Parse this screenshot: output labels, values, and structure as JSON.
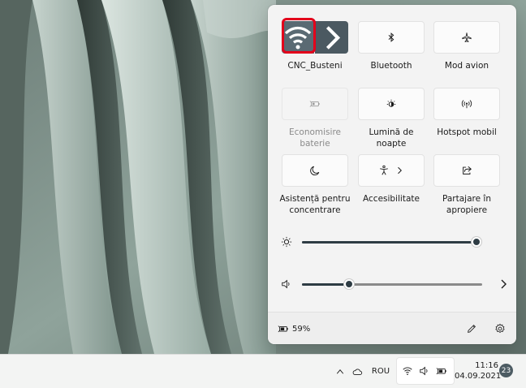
{
  "quick_settings": {
    "tiles": [
      {
        "id": "wifi",
        "label": "CNC_Busteni",
        "icon": "wifi-icon",
        "state": "on",
        "has_chevron": true
      },
      {
        "id": "bluetooth",
        "label": "Bluetooth",
        "icon": "bluetooth-icon",
        "state": "off"
      },
      {
        "id": "airplane",
        "label": "Mod avion",
        "icon": "airplane-icon",
        "state": "off"
      },
      {
        "id": "battery-saver",
        "label": "Economisire\nbaterie",
        "icon": "battery-saver-icon",
        "state": "disabled"
      },
      {
        "id": "night-light",
        "label": "Lumină de\nnoapte",
        "icon": "night-light-icon",
        "state": "off"
      },
      {
        "id": "hotspot",
        "label": "Hotspot mobil",
        "icon": "hotspot-icon",
        "state": "off"
      },
      {
        "id": "focus-assist",
        "label": "Asistență pentru\nconcentrare",
        "icon": "moon-icon",
        "state": "off"
      },
      {
        "id": "accessibility",
        "label": "Accesibilitate",
        "icon": "accessibility-icon",
        "state": "off",
        "has_chevron": true
      },
      {
        "id": "nearby-sharing",
        "label": "Partajare în\napropiere",
        "icon": "share-icon",
        "state": "off"
      }
    ],
    "brightness": {
      "icon": "brightness-icon",
      "level": 1.0
    },
    "volume": {
      "icon": "speaker-icon",
      "level": 0.26
    },
    "battery_text": "59%",
    "footer": {
      "edit_icon": "pencil-icon",
      "settings_icon": "gear-icon"
    }
  },
  "taskbar": {
    "overflow_icon": "chevron-up-icon",
    "cloud_icon": "cloud-icon",
    "language": "ROU",
    "tray_icons": [
      "wifi-icon",
      "speaker-icon",
      "battery-icon"
    ],
    "time": "11:16",
    "date": "04.09.2021",
    "notification_count": "23"
  },
  "colors": {
    "accent_on": "#4c5a62",
    "highlight": "#e3001b",
    "panel_bg": "#f3f3f3",
    "slider_fill": "#2e3c44"
  }
}
